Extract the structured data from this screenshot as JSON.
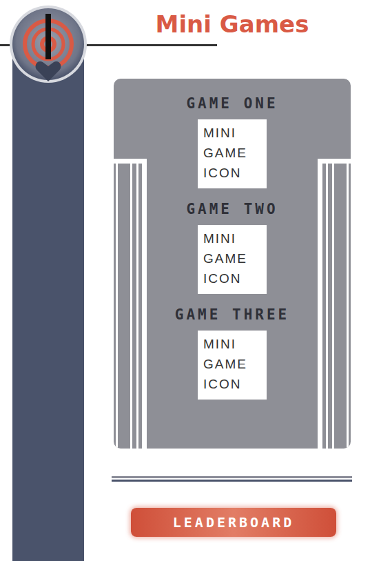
{
  "header": {
    "title": "Mini Games"
  },
  "games": [
    {
      "title": "GAME ONE",
      "icon_lines": [
        "MINI",
        "GAME",
        "ICON"
      ]
    },
    {
      "title": "GAME TWO",
      "icon_lines": [
        "MINI",
        "GAME",
        "ICON"
      ]
    },
    {
      "title": "GAME THREE",
      "icon_lines": [
        "MINI",
        "GAME",
        "ICON"
      ]
    }
  ],
  "leaderboard_button": {
    "label": "LEADERBOARD"
  }
}
